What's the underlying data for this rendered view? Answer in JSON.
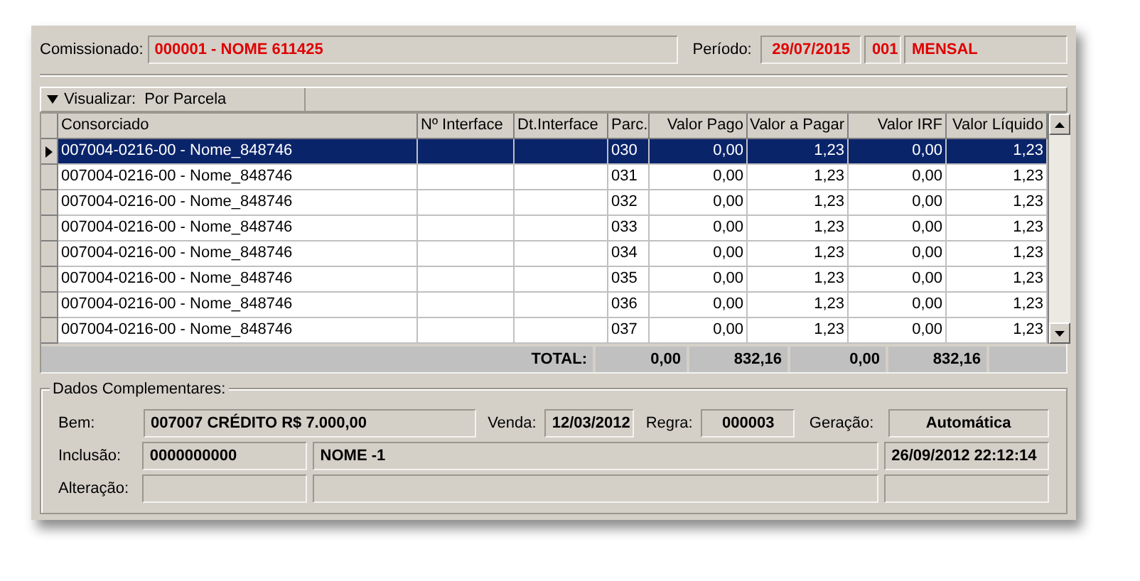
{
  "header": {
    "comissionado_label": "Comissionado:",
    "comissionado_value": "000001 - NOME 611425",
    "periodo_label": "Período:",
    "periodo_date": "29/07/2015",
    "periodo_code": "001",
    "periodo_name": "MENSAL"
  },
  "view_bar": {
    "label": "Visualizar:",
    "value": "Por Parcela",
    "expanded": true
  },
  "table": {
    "columns": [
      "Consorciado",
      "Nº Interface",
      "Dt.Interface",
      "Parc.",
      "Valor Pago",
      "Valor a Pagar",
      "Valor IRF",
      "Valor Líquido"
    ],
    "rows": [
      {
        "selected": true,
        "cells": [
          "007004-0216-00 - Nome_848746",
          "",
          "",
          "030",
          "0,00",
          "1,23",
          "0,00",
          "1,23"
        ]
      },
      {
        "selected": false,
        "cells": [
          "007004-0216-00 - Nome_848746",
          "",
          "",
          "031",
          "0,00",
          "1,23",
          "0,00",
          "1,23"
        ]
      },
      {
        "selected": false,
        "cells": [
          "007004-0216-00 - Nome_848746",
          "",
          "",
          "032",
          "0,00",
          "1,23",
          "0,00",
          "1,23"
        ]
      },
      {
        "selected": false,
        "cells": [
          "007004-0216-00 - Nome_848746",
          "",
          "",
          "033",
          "0,00",
          "1,23",
          "0,00",
          "1,23"
        ]
      },
      {
        "selected": false,
        "cells": [
          "007004-0216-00 - Nome_848746",
          "",
          "",
          "034",
          "0,00",
          "1,23",
          "0,00",
          "1,23"
        ]
      },
      {
        "selected": false,
        "cells": [
          "007004-0216-00 - Nome_848746",
          "",
          "",
          "035",
          "0,00",
          "1,23",
          "0,00",
          "1,23"
        ]
      },
      {
        "selected": false,
        "cells": [
          "007004-0216-00 - Nome_848746",
          "",
          "",
          "036",
          "0,00",
          "1,23",
          "0,00",
          "1,23"
        ]
      },
      {
        "selected": false,
        "cells": [
          "007004-0216-00 - Nome_848746",
          "",
          "",
          "037",
          "0,00",
          "1,23",
          "0,00",
          "1,23"
        ]
      }
    ],
    "total": {
      "label": "TOTAL:",
      "values": [
        "0,00",
        "832,16",
        "0,00",
        "832,16"
      ]
    }
  },
  "details": {
    "title": "Dados Complementares:",
    "bem_label": "Bem:",
    "bem_value": "007007 CRÉDITO R$ 7.000,00",
    "venda_label": "Venda:",
    "venda_value": "12/03/2012",
    "regra_label": "Regra:",
    "regra_value": "000003",
    "geracao_label": "Geração:",
    "geracao_value": "Automática",
    "inclusao_label": "Inclusão:",
    "inclusao_code": "0000000000",
    "inclusao_name": "NOME -1",
    "inclusao_date": "26/09/2012 22:12:14",
    "alteracao_label": "Alteração:"
  }
}
